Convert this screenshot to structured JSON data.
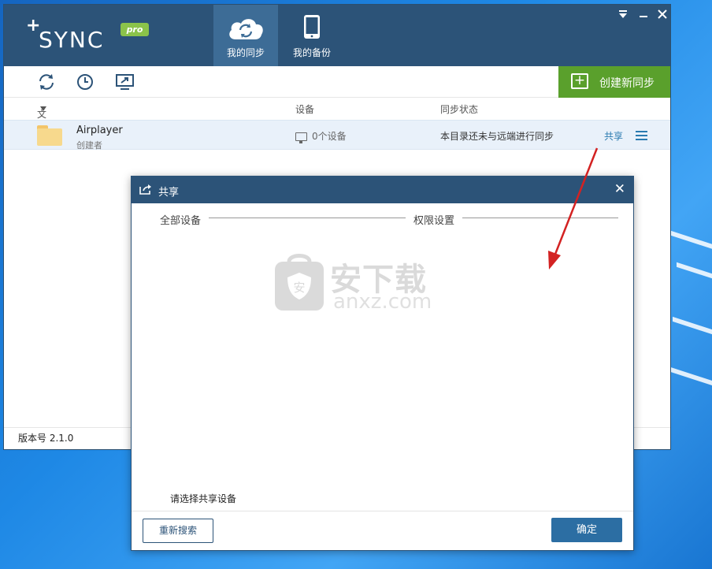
{
  "app": {
    "logo_text": "SYNC",
    "logo_badge": "pro",
    "nav_tabs": [
      {
        "label": "我的同步",
        "icon": "cloud-sync-icon",
        "active": true
      },
      {
        "label": "我的备份",
        "icon": "phone-icon",
        "active": false
      }
    ],
    "window_controls": [
      "minimize-to-tray-icon",
      "minimize-icon",
      "close-icon"
    ]
  },
  "toolbar": {
    "tools": [
      "refresh-icon",
      "clock-icon",
      "screen-share-icon"
    ],
    "create_label": "创建新同步"
  },
  "table": {
    "headers": {
      "file": "文件",
      "device": "设备",
      "status": "同步状态"
    },
    "rows": [
      {
        "name": "Airplayer",
        "role": "创建者",
        "devices": "0个设备",
        "status": "本目录还未与远端进行同步",
        "share": "共享"
      }
    ]
  },
  "footer": {
    "version": "版本号 2.1.0"
  },
  "dialog": {
    "title": "共享",
    "section_all": "全部设备",
    "section_perm": "权限设置",
    "hint": "请选择共享设备",
    "rescan": "重新搜索",
    "ok": "确定"
  },
  "watermark": {
    "cn": "安下载",
    "en": "anxz.com"
  },
  "colors": {
    "header_bg": "#2c5378",
    "accent_green": "#5aa02c",
    "link_blue": "#2a7ab0",
    "arrow_red": "#d32222"
  }
}
